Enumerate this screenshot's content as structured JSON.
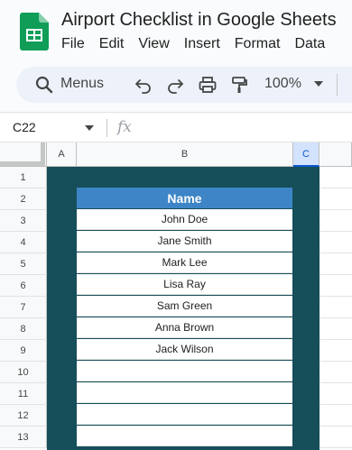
{
  "app": {
    "doc_title": "Airport Checklist in Google Sheets",
    "menu": [
      "File",
      "Edit",
      "View",
      "Insert",
      "Format",
      "Data"
    ]
  },
  "toolbar": {
    "search_label": "Menus",
    "zoom": "100%",
    "icons": [
      "undo-icon",
      "redo-icon",
      "print-icon",
      "paint-format-icon"
    ]
  },
  "formula_bar": {
    "name_box": "C22",
    "fx": "fx"
  },
  "grid": {
    "columns": [
      "A",
      "B",
      "C"
    ],
    "selected_column": "C",
    "rows": [
      "1",
      "2",
      "3",
      "4",
      "5",
      "6",
      "7",
      "8",
      "9",
      "10",
      "11",
      "12",
      "13"
    ],
    "table_header": "Name",
    "names": [
      "John Doe",
      "Jane Smith",
      "Mark Lee",
      "Lisa Ray",
      "Sam Green",
      "Anna Brown",
      "Jack Wilson",
      "",
      "",
      "",
      ""
    ]
  },
  "colors": {
    "teal_background": "#164e5a",
    "header_blue": "#3d85c6",
    "sheets_green": "#0f9d58"
  }
}
